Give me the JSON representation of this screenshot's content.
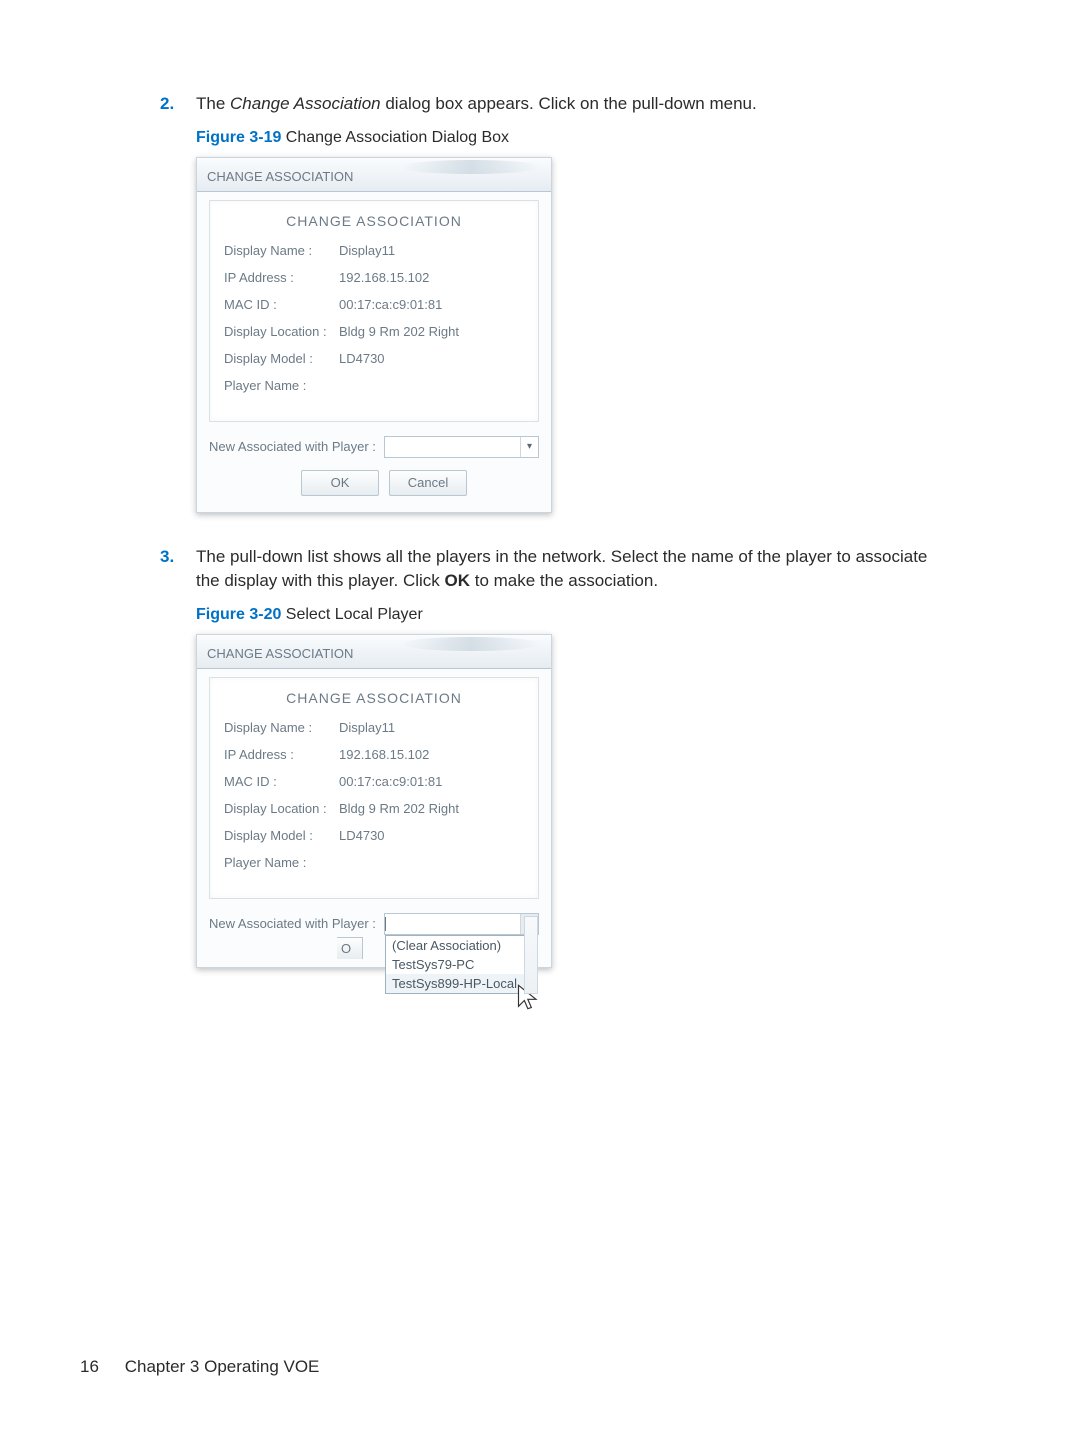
{
  "steps": {
    "s2": {
      "num": "2.",
      "text_before": "The ",
      "text_italic": "Change Association",
      "text_after": " dialog box appears. Click on the pull-down menu."
    },
    "s3": {
      "num": "3.",
      "text_a": "The pull-down list shows all the players in the network. Select the name of the player to associate the display with this player. Click ",
      "text_bold": "OK",
      "text_b": " to make the association."
    }
  },
  "figures": {
    "f19": {
      "ref": "Figure 3-19",
      "caption": "  Change Association Dialog Box"
    },
    "f20": {
      "ref": "Figure 3-20",
      "caption": "  Select Local Player"
    }
  },
  "dialog": {
    "window_title": "CHANGE ASSOCIATION",
    "panel_title": "CHANGE ASSOCIATION",
    "rows": {
      "display_name": {
        "label": "Display Name :",
        "value": "Display11"
      },
      "ip": {
        "label": "IP Address :",
        "value": "192.168.15.102"
      },
      "mac": {
        "label": "MAC ID :",
        "value": "00:17:ca:c9:01:81"
      },
      "loc": {
        "label": "Display Location :",
        "value": "Bldg 9 Rm 202 Right"
      },
      "model": {
        "label": "Display Model :",
        "value": "LD4730"
      },
      "player": {
        "label": "Player Name :",
        "value": ""
      }
    },
    "assoc_label": "New Associated with Player :",
    "buttons": {
      "ok": "OK",
      "cancel": "Cancel"
    },
    "dropdown": {
      "items": [
        "(Clear Association)",
        "TestSys79-PC",
        "TestSys899-HP-Local"
      ]
    },
    "ok_clip": "O"
  },
  "footer": {
    "page": "16",
    "chapter": "Chapter 3   Operating VOE"
  }
}
